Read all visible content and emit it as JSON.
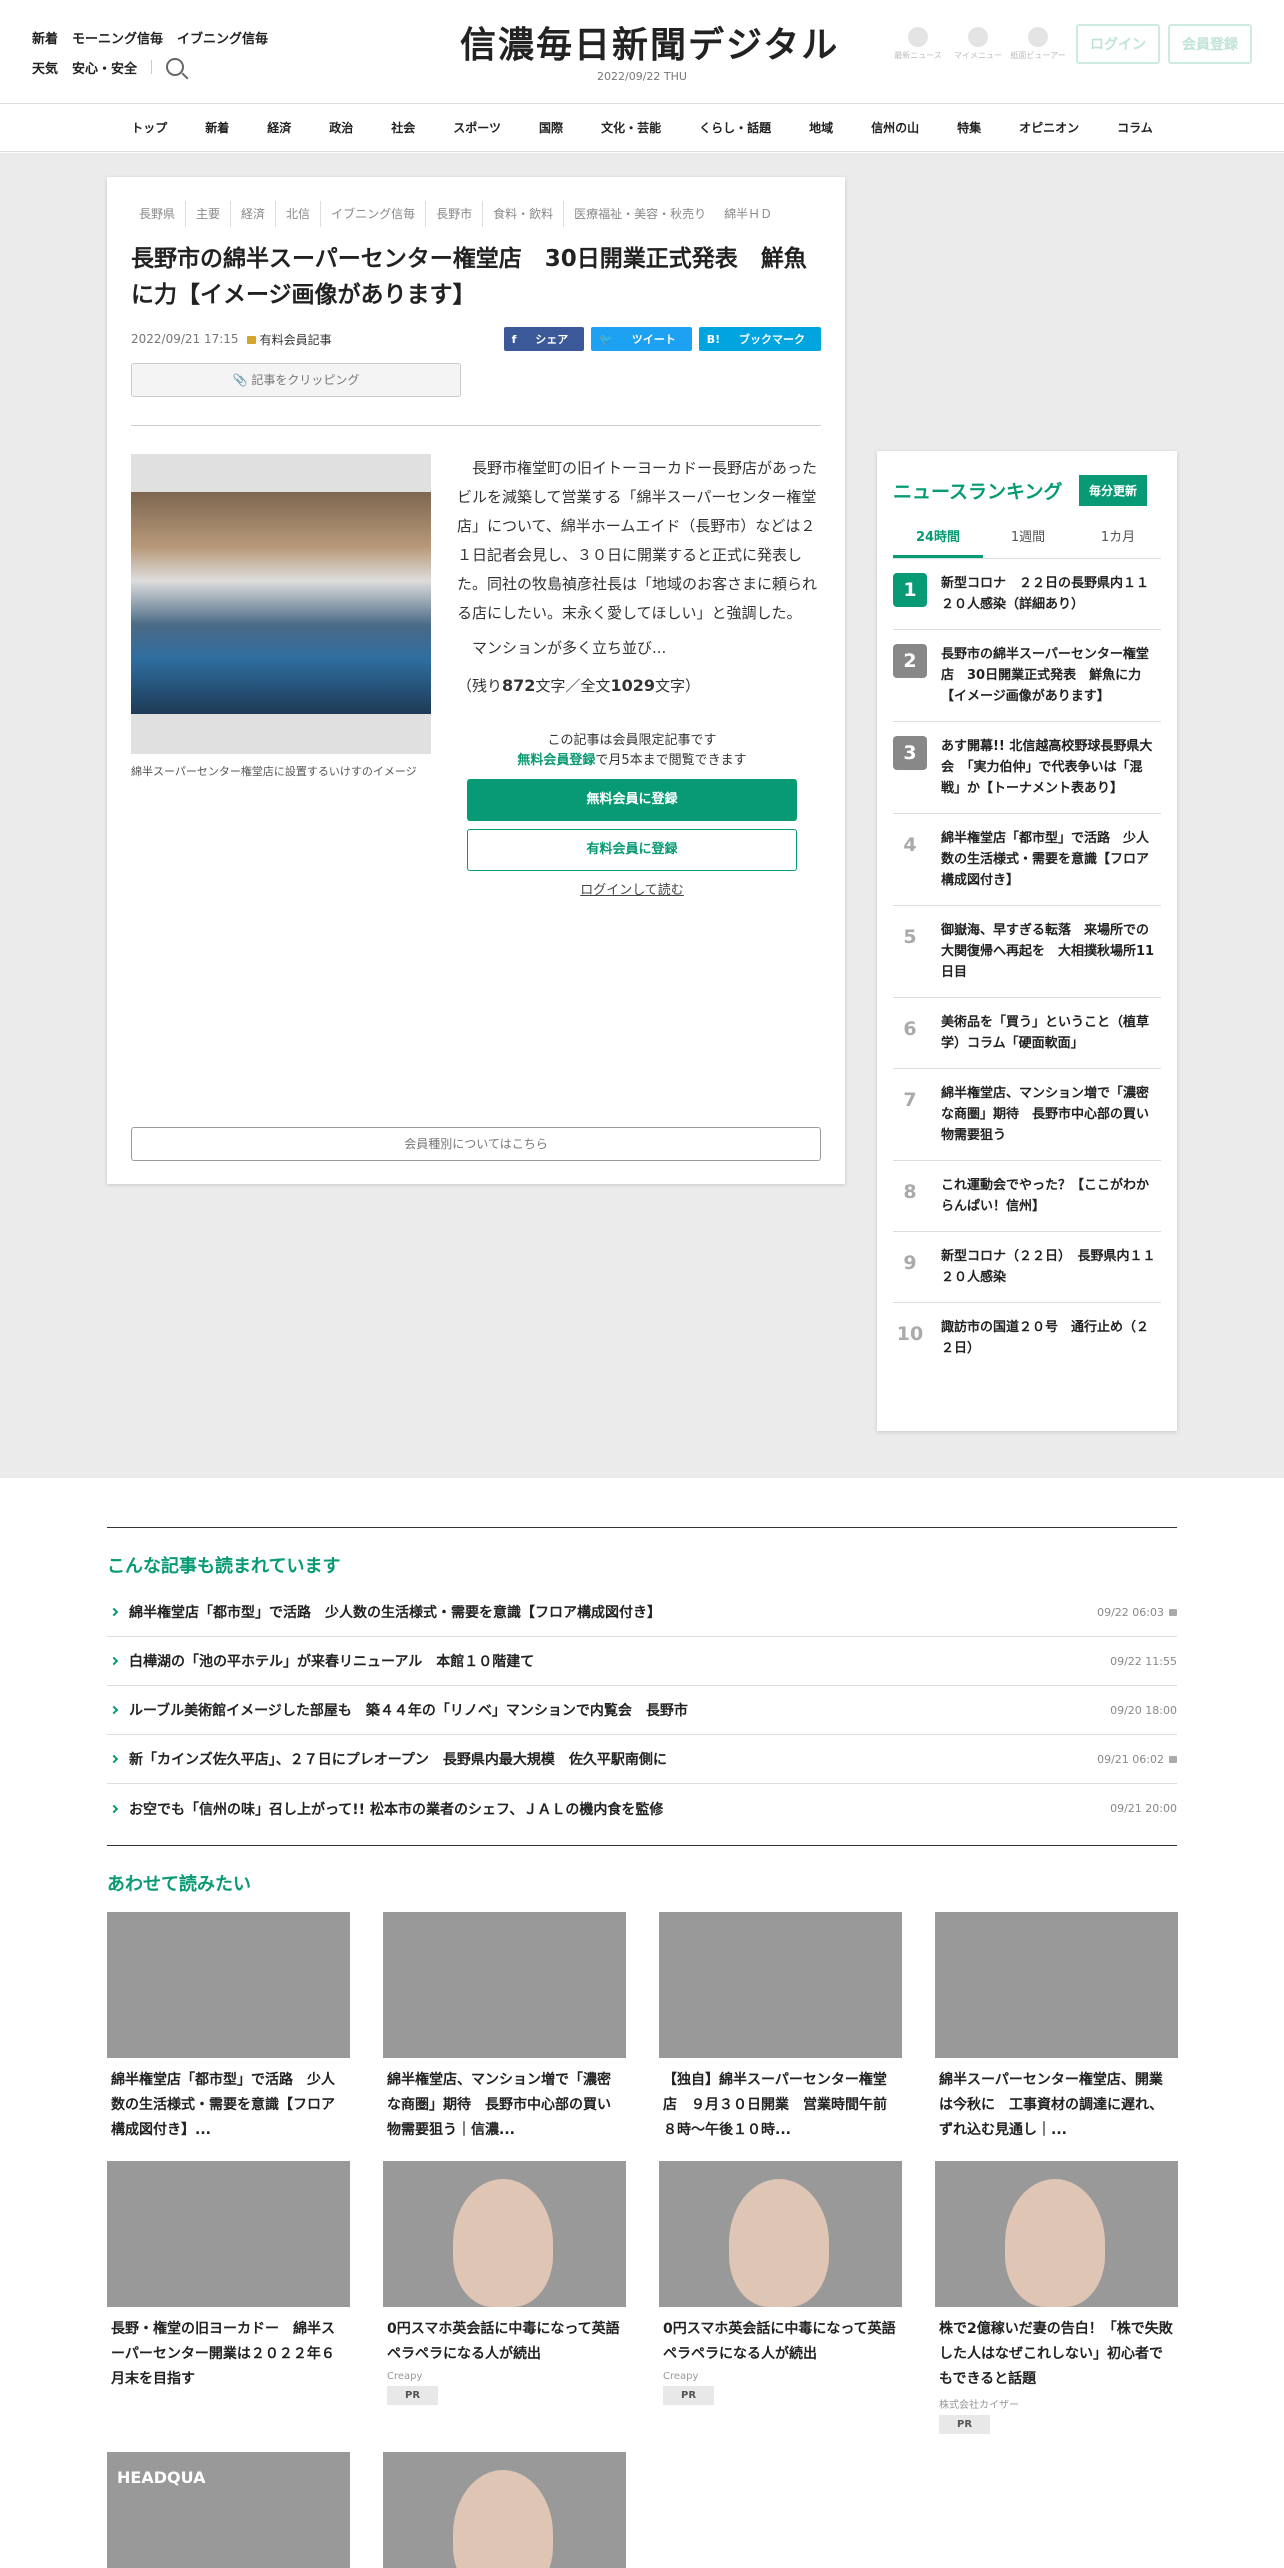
{
  "header": {
    "left_row1": [
      "新着",
      "モーニング信毎",
      "イブニング信毎"
    ],
    "left_row2": [
      "天気",
      "安心・安全"
    ],
    "logo": "信濃毎日新聞デジタル",
    "date": "2022/09/22",
    "weekday": "THU",
    "icons": [
      {
        "label": "最新ニュース",
        "icon": "pin-icon"
      },
      {
        "label": "マイメニュー",
        "icon": "user-icon"
      },
      {
        "label": "紙面ビューアー",
        "icon": "paper-icon"
      }
    ],
    "login": "ログイン",
    "register": "会員登録"
  },
  "nav": [
    "トップ",
    "新着",
    "経済",
    "政治",
    "社会",
    "スポーツ",
    "国際",
    "文化・芸能",
    "くらし・話題",
    "地域",
    "信州の山",
    "特集",
    "オピニオン",
    "コラム"
  ],
  "article": {
    "tags": [
      "長野県",
      "主要",
      "経済",
      "北信",
      "イブニング信毎",
      "長野市",
      "食料・飲料",
      "医療福祉・美容・秋売り",
      "綿半ＨＤ"
    ],
    "title": "長野市の綿半スーパーセンター権堂店　30日開業正式発表　鮮魚に力【イメージ画像があります】",
    "date": "2022/09/21 17:15",
    "paid": "有料会員記事",
    "share": [
      "シェア",
      "ツイート",
      "ブックマーク"
    ],
    "clip": "記事をクリッピング",
    "caption": "綿半スーパーセンター権堂店に設置するいけすのイメージ",
    "para1": "長野市権堂町の旧イトーヨーカドー長野店があったビルを減築して営業する「綿半スーパーセンター権堂店」について、綿半ホームエイド（長野市）などは２１日記者会見し、３０日に開業すると正式に発表した。同社の牧島禎彦社長は「地域のお客さまに頼られる店にしたい。末永く愛してほしい」と強調した。",
    "para2": "マンションが多く立ち並び...",
    "remain_pre": "（残り",
    "remain_num": "872",
    "remain_mid": "文字／全文",
    "total_num": "1029",
    "remain_post": "文字）",
    "member_msg": "この記事は会員限定記事です",
    "free_link": "無料会員登録",
    "free_msg": "で月5本まで閲覧できます",
    "free_btn": "無料会員に登録",
    "paid_btn": "有料会員に登録",
    "login_link": "ログインして読む",
    "member_types": "会員種別についてはこちら"
  },
  "ranking": {
    "title": "ニュースランキング",
    "badge": "毎分更新",
    "tabs": [
      "24時間",
      "1週間",
      "1カ月"
    ],
    "items": [
      {
        "n": "1",
        "t": "新型コロナ　２２日の長野県内１１２０人感染（詳細あり）"
      },
      {
        "n": "2",
        "t": "長野市の綿半スーパーセンター権堂店　30日開業正式発表　鮮魚に力【イメージ画像があります】"
      },
      {
        "n": "3",
        "t": "あす開幕!! 北信越高校野球長野県大会　「実力伯仲」で代表争いは「混戦」か【トーナメント表あり】"
      },
      {
        "n": "4",
        "t": "綿半権堂店「都市型」で活路　少人数の生活様式・需要を意識【フロア構成図付き】"
      },
      {
        "n": "5",
        "t": "御嶽海、早すぎる転落　来場所での大関復帰へ再起を　大相撲秋場所11日目"
      },
      {
        "n": "6",
        "t": "美術品を「買う」ということ（植草学）コラム「硬面軟面」"
      },
      {
        "n": "7",
        "t": "綿半権堂店、マンション増で「濃密な商圏」期待　長野市中心部の買い物需要狙う"
      },
      {
        "n": "8",
        "t": "これ運動会でやった？【ここがわからんぱい！信州】"
      },
      {
        "n": "9",
        "t": "新型コロナ（２２日）　長野県内１１２０人感染"
      },
      {
        "n": "10",
        "t": "諏訪市の国道２０号　通行止め（２２日）"
      }
    ]
  },
  "read": {
    "title": "こんな記事も読まれています",
    "items": [
      {
        "t": "綿半権堂店「都市型」で活路　少人数の生活様式・需要を意識【フロア構成図付き】",
        "d": "09/22 06:03",
        "lock": true
      },
      {
        "t": "白樺湖の「池の平ホテル」が来春リニューアル　本館１０階建て",
        "d": "09/22 11:55",
        "lock": false
      },
      {
        "t": "ルーブル美術館イメージした部屋も　築４４年の「リノベ」マンションで内覧会　長野市",
        "d": "09/20 18:00",
        "lock": false
      },
      {
        "t": "新「カインズ佐久平店」、２７日にプレオープン　長野県内最大規模　佐久平駅南側に",
        "d": "09/21 06:02",
        "lock": true
      },
      {
        "t": "お空でも「信州の味」召し上がって!! 松本市の業者のシェフ、ＪＡＬの機内食を監修",
        "d": "09/21 20:00",
        "lock": false
      }
    ]
  },
  "also": {
    "title": "あわせて読みたい",
    "cards": [
      {
        "t": "綿半権堂店「都市型」で活路　少人数の生活様式・需要を意識【フロア構成図付き】...",
        "sp": "",
        "pr": ""
      },
      {
        "t": "綿半権堂店、マンション増で「濃密な商圏」期待　長野市中心部の買い物需要狙う｜信濃...",
        "sp": "",
        "pr": ""
      },
      {
        "t": "【独自】綿半スーパーセンター権堂店　９月３０日開業　営業時間午前８時～午後１０時...",
        "sp": "",
        "pr": ""
      },
      {
        "t": "綿半スーパーセンター権堂店、開業は今秋に　工事資材の調達に遅れ、ずれ込む見通し｜...",
        "sp": "",
        "pr": ""
      },
      {
        "t": "長野・権堂の旧ヨーカドー　綿半スーパーセンター開業は２０２２年６月末を目指す",
        "sp": "",
        "pr": ""
      },
      {
        "t": "0円スマホ英会話に中毒になって英語ペラペラになる人が続出",
        "sp": "Creapy",
        "pr": "PR"
      },
      {
        "t": "0円スマホ英会話に中毒になって英語ペラペラになる人が続出",
        "sp": "Creapy",
        "pr": "PR"
      },
      {
        "t": "株で2億稼いだ妻の告白！「株で失敗した人はなぜこれしない」初心者でもできると話題",
        "sp": "株式会社カイザー",
        "pr": "PR"
      },
      {
        "t": "",
        "sp": "",
        "pr": ""
      },
      {
        "t": "",
        "sp": "",
        "pr": ""
      }
    ],
    "card9_sign": "HEADQUA"
  },
  "colors": {
    "accent": "#079a74",
    "facebook": "#3b5998",
    "twitter": "#1da1f2",
    "hatena": "#00a4de"
  }
}
